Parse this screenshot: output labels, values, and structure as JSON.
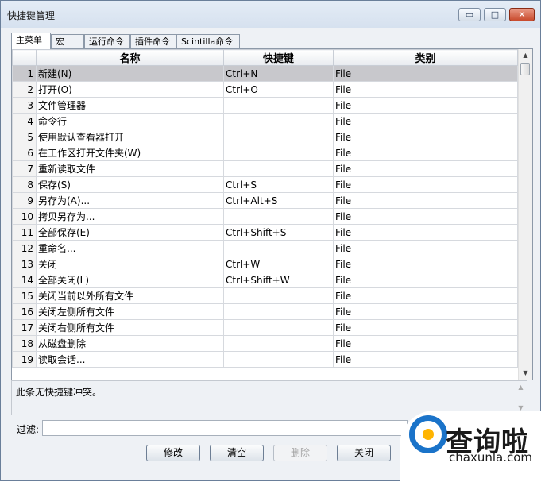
{
  "window": {
    "title": "快捷键管理"
  },
  "title_buttons": {
    "minimize": "▭",
    "maximize": "□",
    "close": "✕"
  },
  "tabs": [
    {
      "label": "主菜单",
      "active": true
    },
    {
      "label": "宏",
      "active": false
    },
    {
      "label": "运行命令",
      "active": false
    },
    {
      "label": "插件命令",
      "active": false
    },
    {
      "label": "Scintilla命令",
      "active": false
    }
  ],
  "table": {
    "columns": [
      "名称",
      "快捷键",
      "类别"
    ],
    "rows": [
      {
        "num": "1",
        "name": "新建(N)",
        "shortcut": "Ctrl+N",
        "category": "File",
        "selected": true
      },
      {
        "num": "2",
        "name": "打开(O)",
        "shortcut": "Ctrl+O",
        "category": "File"
      },
      {
        "num": "3",
        "name": "文件管理器",
        "shortcut": "",
        "category": "File"
      },
      {
        "num": "4",
        "name": "命令行",
        "shortcut": "",
        "category": "File"
      },
      {
        "num": "5",
        "name": "使用默认查看器打开",
        "shortcut": "",
        "category": "File"
      },
      {
        "num": "6",
        "name": "在工作区打开文件夹(W)",
        "shortcut": "",
        "category": "File"
      },
      {
        "num": "7",
        "name": "重新读取文件",
        "shortcut": "",
        "category": "File"
      },
      {
        "num": "8",
        "name": "保存(S)",
        "shortcut": "Ctrl+S",
        "category": "File"
      },
      {
        "num": "9",
        "name": "另存为(A)...",
        "shortcut": "Ctrl+Alt+S",
        "category": "File"
      },
      {
        "num": "10",
        "name": "拷贝另存为...",
        "shortcut": "",
        "category": "File"
      },
      {
        "num": "11",
        "name": "全部保存(E)",
        "shortcut": "Ctrl+Shift+S",
        "category": "File"
      },
      {
        "num": "12",
        "name": "重命名...",
        "shortcut": "",
        "category": "File"
      },
      {
        "num": "13",
        "name": "关闭",
        "shortcut": "Ctrl+W",
        "category": "File"
      },
      {
        "num": "14",
        "name": "全部关闭(L)",
        "shortcut": "Ctrl+Shift+W",
        "category": "File"
      },
      {
        "num": "15",
        "name": "关闭当前以外所有文件",
        "shortcut": "",
        "category": "File"
      },
      {
        "num": "16",
        "name": "关闭左侧所有文件",
        "shortcut": "",
        "category": "File"
      },
      {
        "num": "17",
        "name": "关闭右侧所有文件",
        "shortcut": "",
        "category": "File"
      },
      {
        "num": "18",
        "name": "从磁盘删除",
        "shortcut": "",
        "category": "File"
      },
      {
        "num": "19",
        "name": "读取会话...",
        "shortcut": "",
        "category": "File"
      }
    ]
  },
  "status": {
    "message": "此条无快捷键冲突。"
  },
  "filter": {
    "label": "过滤:",
    "value": ""
  },
  "buttons": {
    "modify": "修改",
    "clear": "清空",
    "delete": "删除",
    "close": "关闭"
  },
  "watermark": {
    "brand": "查询啦",
    "url": "chaxunla.com"
  },
  "scroll": {
    "up": "▲",
    "down": "▼"
  }
}
